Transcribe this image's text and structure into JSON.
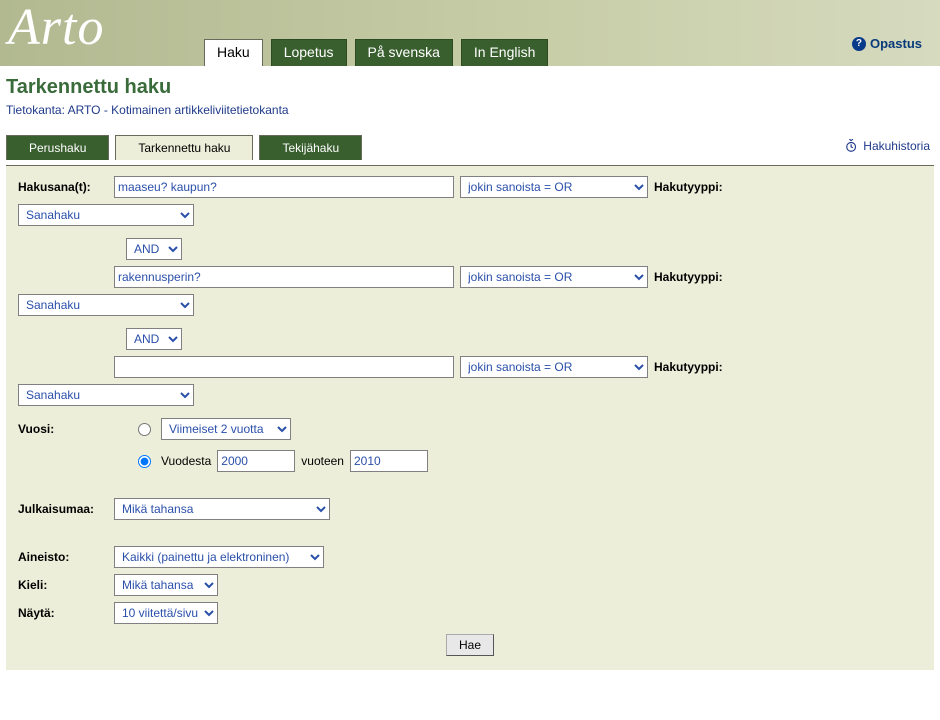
{
  "brand": "Arto",
  "help_link": "Opastus",
  "main_tabs": {
    "items": [
      {
        "label": "Haku",
        "active": true
      },
      {
        "label": "Lopetus"
      },
      {
        "label": "På svenska"
      },
      {
        "label": "In English"
      }
    ]
  },
  "page_title": "Tarkennettu haku",
  "db_line": "Tietokanta: ARTO - Kotimainen artikkeliviitetietokanta",
  "history_link": "Hakuhistoria",
  "search_tabs": {
    "items": [
      {
        "label": "Perushaku"
      },
      {
        "label": "Tarkennettu haku",
        "active": true
      },
      {
        "label": "Tekijähaku"
      }
    ]
  },
  "labels": {
    "hakusanat": "Hakusana(t):",
    "hakutyyppi": "Hakutyyppi:",
    "vuosi": "Vuosi:",
    "vuodesta": "Vuodesta",
    "vuoteen": "vuoteen",
    "julkaisumaa": "Julkaisumaa:",
    "aineisto": "Aineisto:",
    "kieli": "Kieli:",
    "nayta": "Näytä:"
  },
  "query": {
    "rows": [
      {
        "term": "maaseu? kaupun?",
        "match": "jokin sanoista = OR",
        "type": "Sanahaku"
      },
      {
        "bool": "AND",
        "term": "rakennusperin?",
        "match": "jokin sanoista = OR",
        "type": "Sanahaku"
      },
      {
        "bool": "AND",
        "term": "",
        "match": "jokin sanoista = OR",
        "type": "Sanahaku"
      }
    ]
  },
  "year": {
    "mode": "range",
    "preset": "Viimeiset 2 vuotta",
    "from": "2000",
    "to": "2010"
  },
  "julkaisumaa": "Mikä tahansa",
  "aineisto": "Kaikki (painettu ja elektroninen)",
  "kieli": "Mikä tahansa",
  "nayta": "10 viitettä/sivu",
  "submit": "Hae"
}
